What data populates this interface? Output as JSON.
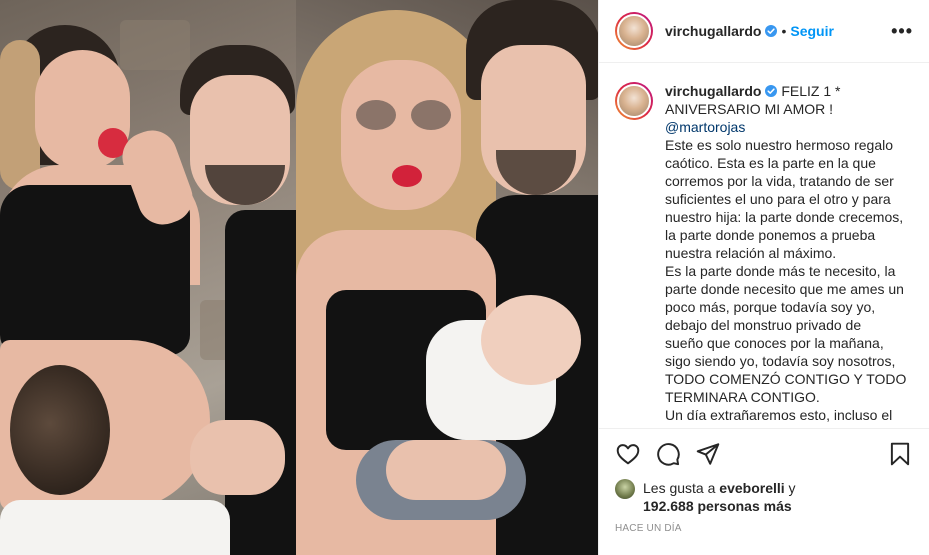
{
  "post": {
    "author": "virchugallardo",
    "follow_label": "Seguir",
    "more_label": "•••",
    "separator": "•"
  },
  "caption": {
    "author": "virchugallardo",
    "lines": [
      "FELIZ 1 *",
      "ANIVERSARIO MI AMOR !",
      "@martorojas",
      "Este es solo nuestro hermoso regalo",
      "caótico. Esta es la parte en la que",
      "corremos por la vida, tratando de ser",
      "suficientes el uno para el otro y para",
      "nuestro hija: la parte donde crecemos,",
      "la parte donde ponemos a prueba",
      "nuestra relación al máximo.",
      "Es la parte donde más te necesito, la",
      "parte donde necesito que me ames un",
      "poco más, porque todavía soy yo,",
      "debajo del monstruo privado de",
      "sueño que conoces por la mañana,",
      "sigo siendo yo, todavía soy nosotros,",
      "TODO COMENZÓ CONTIGO Y TODO",
      "TERMINARA CONTIGO.",
      "Un día extrañaremos esto, incluso el"
    ]
  },
  "likes": {
    "prefix": "Les gusta a",
    "first_user": "eveborelli",
    "connector": "y",
    "others_count": "192.688 personas más"
  },
  "timestamp": "HACE UN DÍA",
  "colors": {
    "link": "#0095f6",
    "mention": "#00376b",
    "verified": "#3897f0",
    "muted": "#8e8e8e"
  }
}
